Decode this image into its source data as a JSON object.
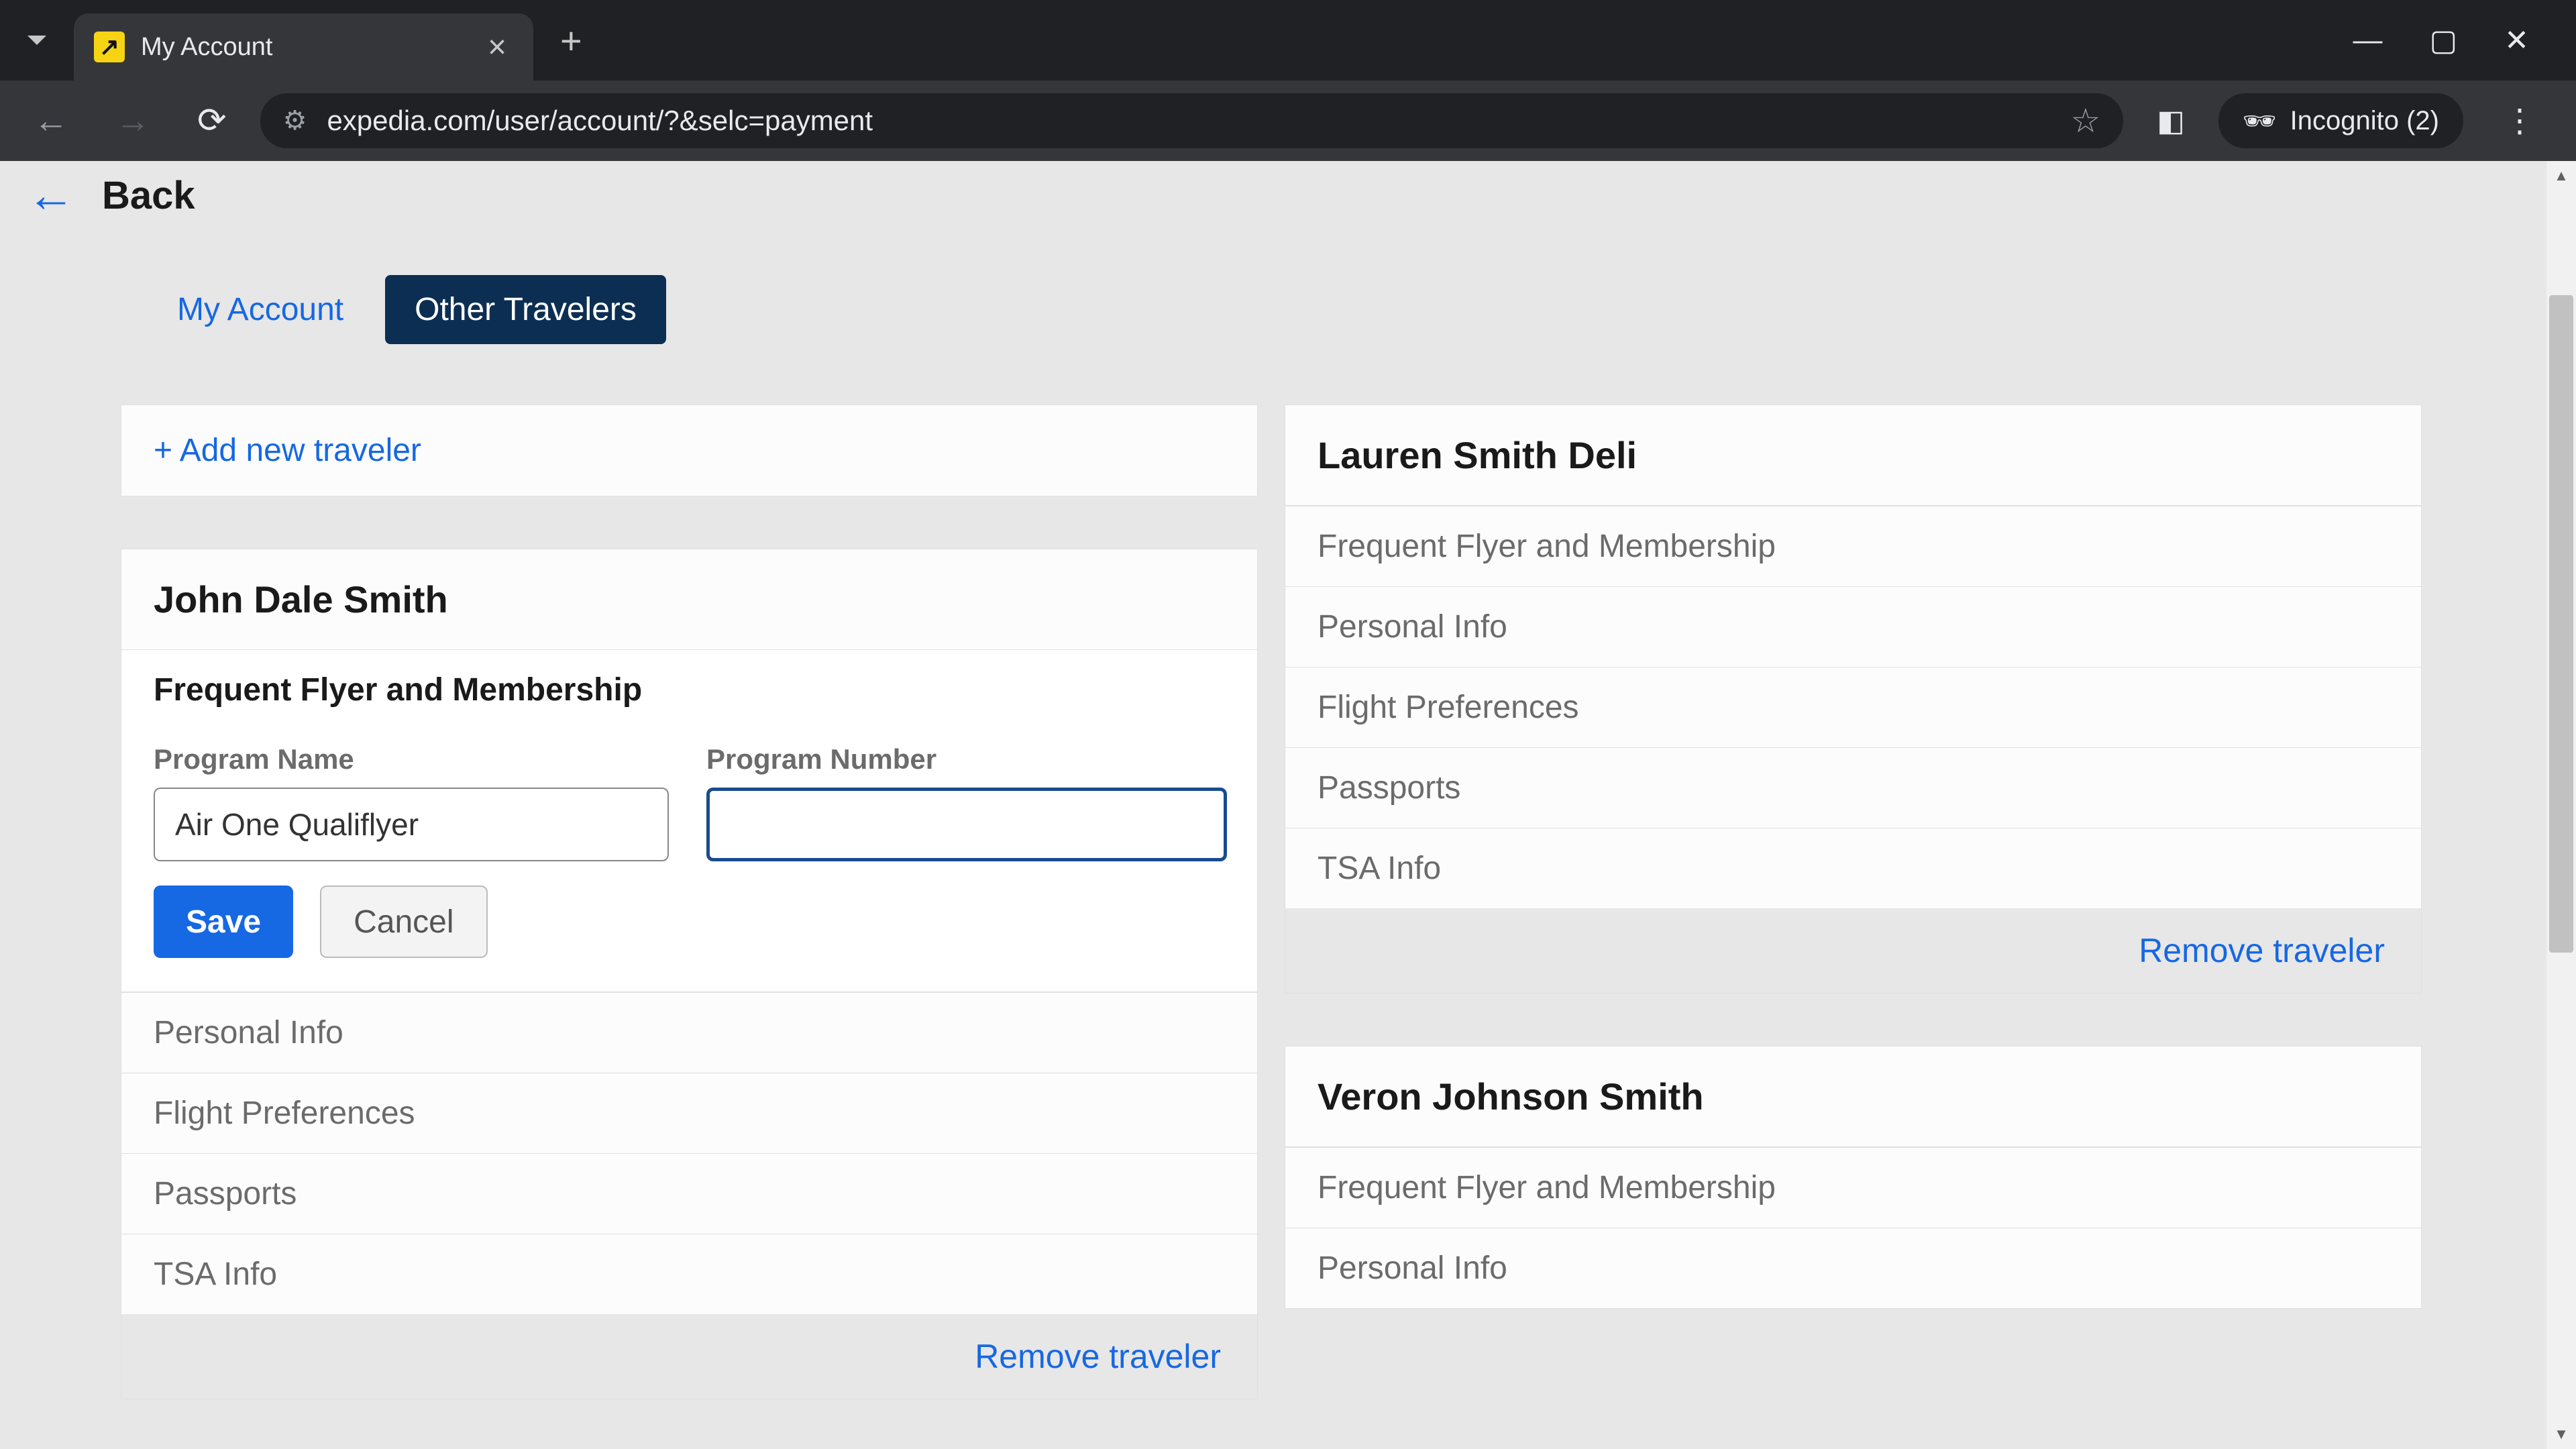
{
  "browser": {
    "tab_title": "My Account",
    "url": "expedia.com/user/account/?&selc=payment",
    "incognito_label": "Incognito (2)"
  },
  "back": {
    "label": "Back"
  },
  "tabs": {
    "my_account": "My Account",
    "other_travelers": "Other Travelers"
  },
  "add_link": "+ Add new traveler",
  "sections": {
    "ffm": "Frequent Flyer and Membership",
    "personal": "Personal Info",
    "flight": "Flight Preferences",
    "passports": "Passports",
    "tsa": "TSA Info"
  },
  "form": {
    "program_name_label": "Program Name",
    "program_number_label": "Program Number",
    "program_name_value": "Air One Qualiflyer",
    "program_number_value": "",
    "save": "Save",
    "cancel": "Cancel"
  },
  "remove_label": "Remove traveler",
  "travelers": {
    "t1": {
      "name": "John Dale Smith"
    },
    "t2": {
      "name": "Lauren Smith Deli"
    },
    "t3": {
      "name": "Veron Johnson Smith"
    }
  }
}
